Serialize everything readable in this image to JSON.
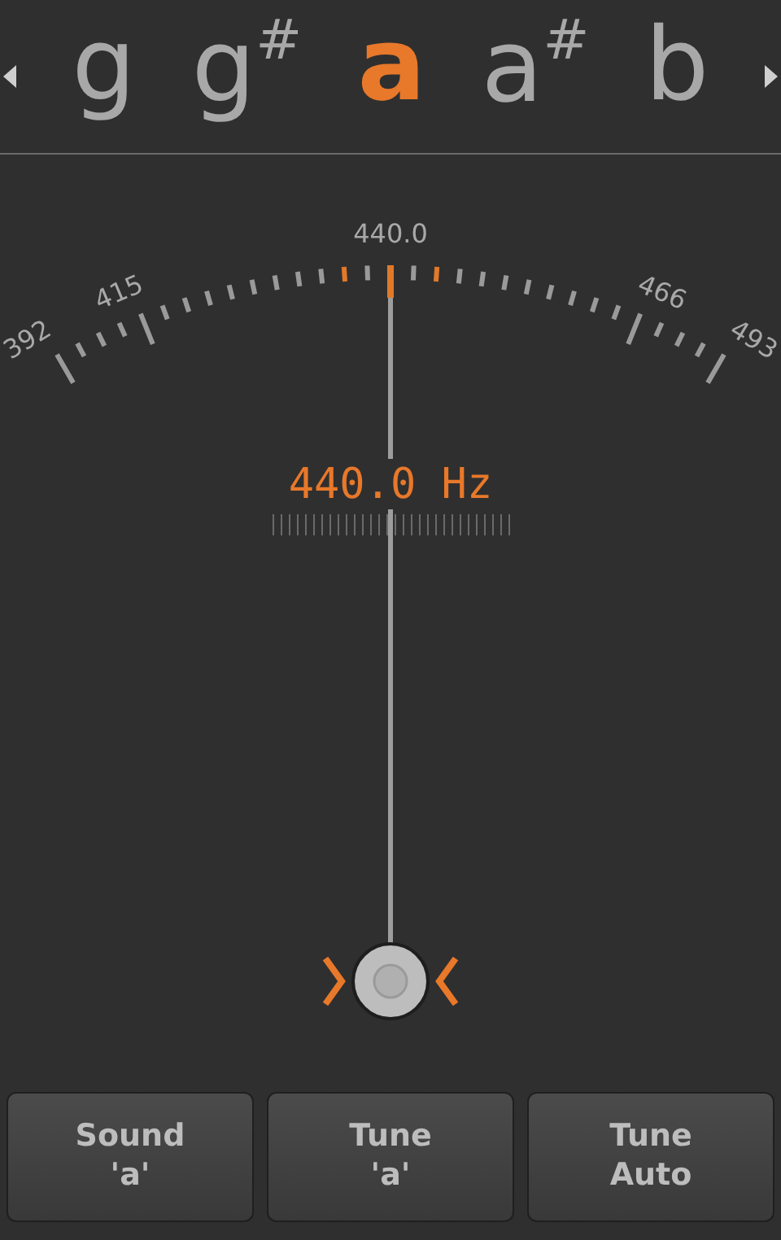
{
  "notes": [
    {
      "letter": "g",
      "selected": false
    },
    {
      "letter": "g",
      "sharp": "#",
      "selected": false
    },
    {
      "letter": "a",
      "selected": true
    },
    {
      "letter": "a",
      "sharp": "#",
      "selected": false
    },
    {
      "letter": "b",
      "selected": false
    }
  ],
  "gauge": {
    "scale_labels": [
      "392",
      "415",
      "440.0",
      "466",
      "493"
    ],
    "level": 0.5,
    "reading": "440.0 Hz"
  },
  "buttons": [
    {
      "lines": [
        "Sound",
        "'a'"
      ]
    },
    {
      "lines": [
        "Tune",
        "'a'"
      ]
    },
    {
      "lines": [
        "Tune",
        "Auto"
      ]
    }
  ]
}
